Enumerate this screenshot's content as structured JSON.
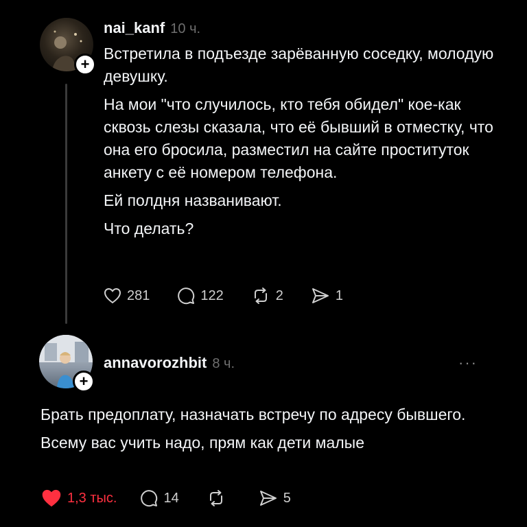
{
  "post": {
    "username": "nai_kanf",
    "timestamp": "10 ч.",
    "paragraphs": [
      "Встретила в подъезде зарёванную соседку, молодую девушку.",
      "На мои \"что случилось, кто тебя обидел\" кое-как сквозь слезы сказала, что её бывший в отместку, что она его бросила, разместил на сайте проституток анкету с её номером телефона.",
      "Ей полдня названивают.",
      "Что делать?"
    ],
    "likes": "281",
    "comments": "122",
    "reposts": "2",
    "shares": "1"
  },
  "reply": {
    "username": "annavorozhbit",
    "timestamp": "8 ч.",
    "more": "···",
    "paragraphs": [
      "Брать предоплату, назначать встречу по адресу бывшего.",
      "Всему вас учить надо, прям как дети малые"
    ],
    "likes": "1,3 тыс.",
    "comments": "14",
    "shares": "5"
  },
  "icons": {
    "like": "heart-icon",
    "comment": "comment-bubble-icon",
    "repost": "repost-icon",
    "share": "send-icon",
    "follow": "plus-icon"
  },
  "colors": {
    "background": "#000000",
    "text": "#f3f5f7",
    "muted": "#6f6f6f",
    "liked": "#ff3040"
  }
}
